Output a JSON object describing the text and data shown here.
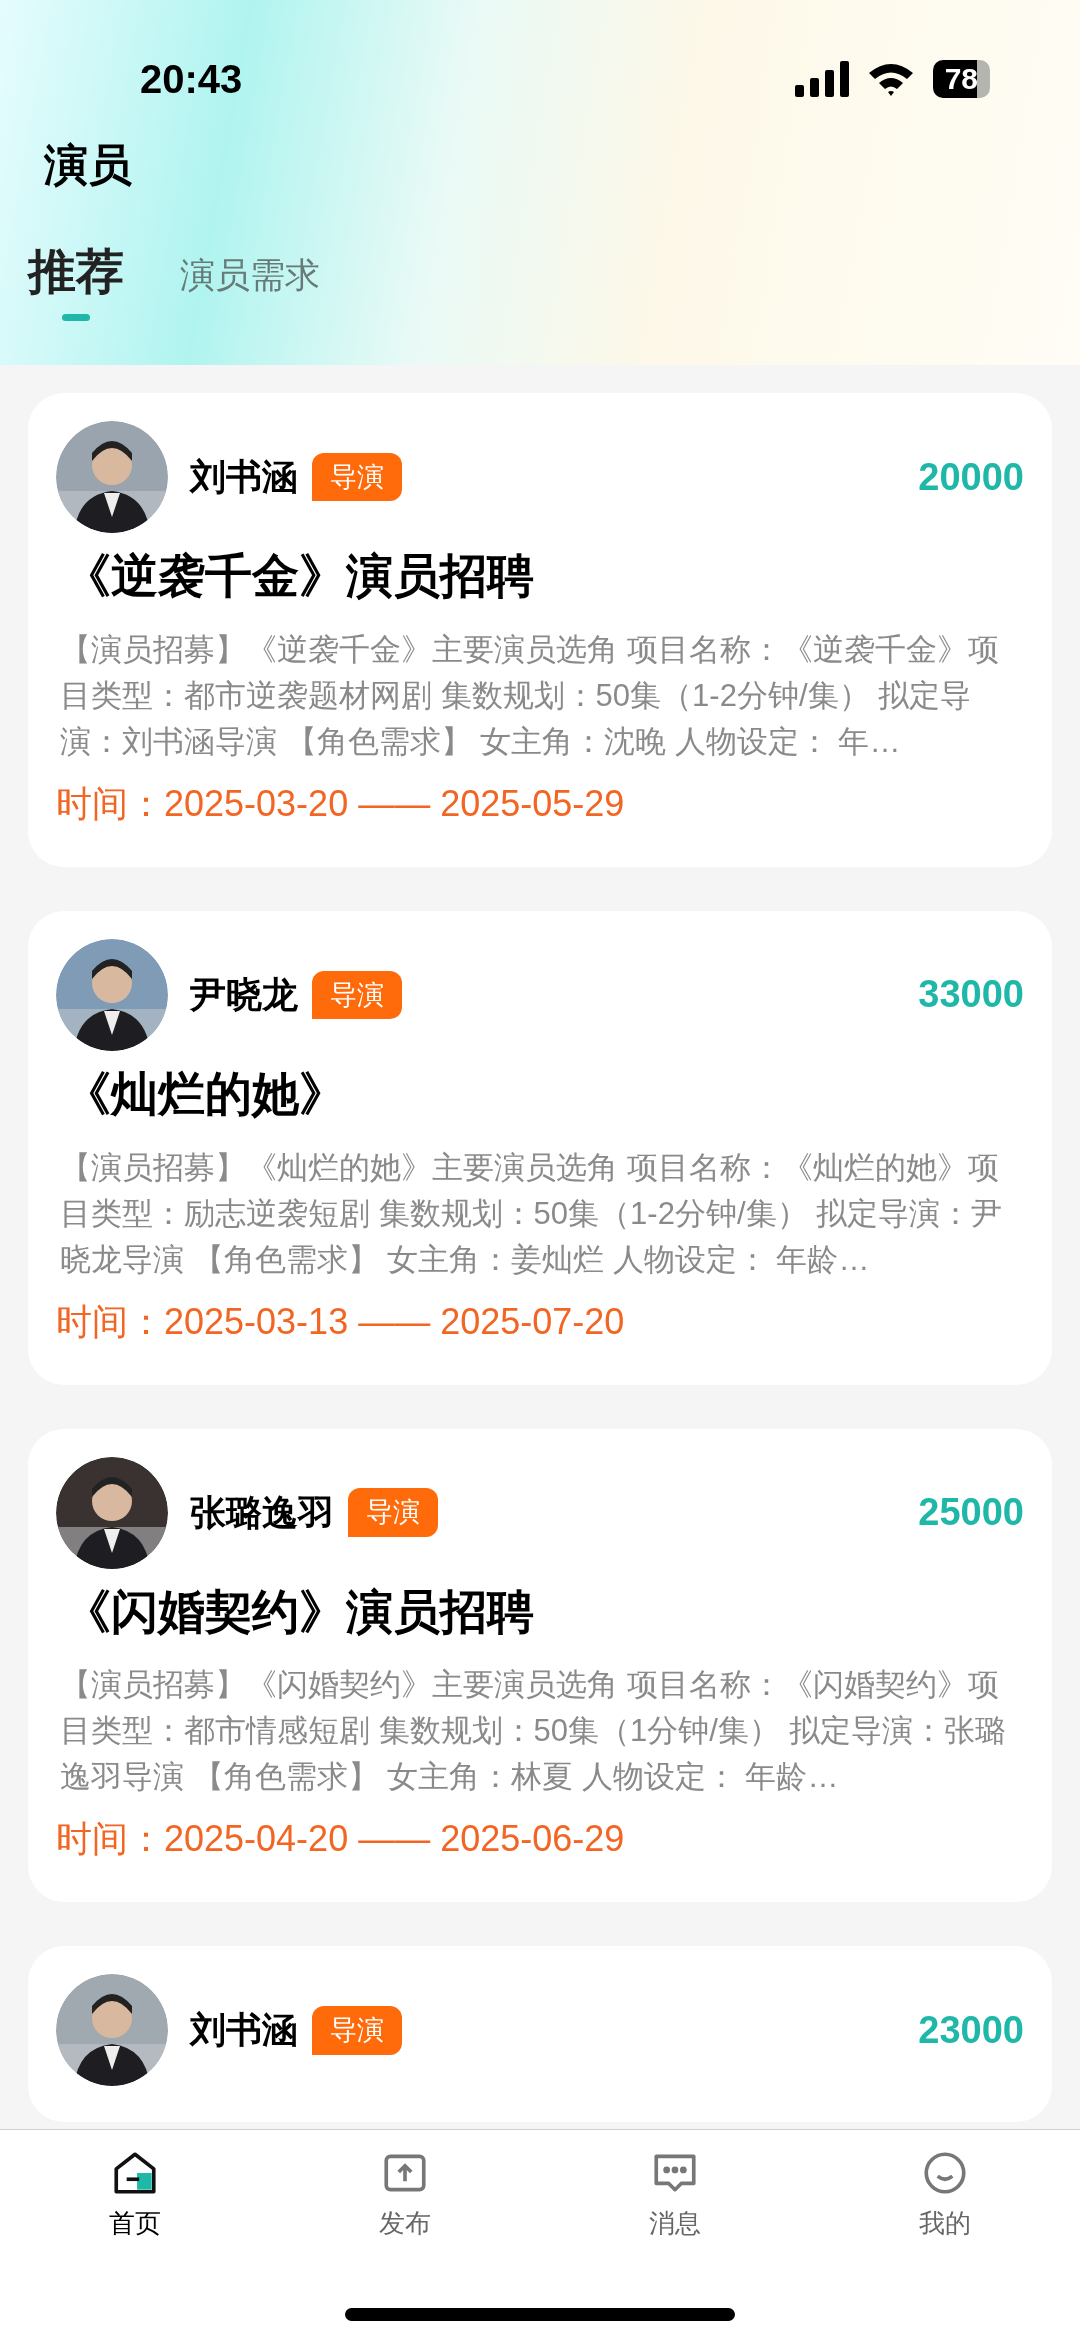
{
  "status_bar": {
    "time": "20:43",
    "battery": "78"
  },
  "page_title": "演员",
  "tabs": [
    {
      "label": "推荐",
      "selected": true
    },
    {
      "label": "演员需求",
      "selected": false
    }
  ],
  "cards": [
    {
      "name": "刘书涵",
      "role": "导演",
      "price": "20000",
      "title": "《逆袭千金》演员招聘",
      "description": "【演员招募】《逆袭千金》主要演员选角 项目名称：《逆袭千金》项目类型：都市逆袭题材网剧 集数规划：50集（1-2分钟/集） 拟定导演：刘书涵导演 【角色需求】 女主角：沈晚 人物设定： 年…",
      "time": "时间：2025-03-20 —— 2025-05-29"
    },
    {
      "name": "尹晓龙",
      "role": "导演",
      "price": "33000",
      "title": "《灿烂的她》",
      "description": "【演员招募】《灿烂的她》主要演员选角 项目名称：《灿烂的她》项目类型：励志逆袭短剧 集数规划：50集（1-2分钟/集） 拟定导演：尹晓龙导演 【角色需求】 女主角：姜灿烂 人物设定： 年龄…",
      "time": "时间：2025-03-13 —— 2025-07-20"
    },
    {
      "name": "张璐逸羽",
      "role": "导演",
      "price": "25000",
      "title": "《闪婚契约》演员招聘",
      "description": "【演员招募】《闪婚契约》主要演员选角 项目名称：《闪婚契约》项目类型：都市情感短剧 集数规划：50集（1分钟/集） 拟定导演：张璐逸羽导演 【角色需求】 女主角：林夏 人物设定： 年龄…",
      "time": "时间：2025-04-20 —— 2025-06-29"
    },
    {
      "name": "刘书涵",
      "role": "导演",
      "price": "23000"
    }
  ],
  "bottom_nav": [
    {
      "label": "首页",
      "kind": "home",
      "selected": true
    },
    {
      "label": "发布",
      "kind": "publish",
      "selected": false
    },
    {
      "label": "消息",
      "kind": "message",
      "selected": false
    },
    {
      "label": "我的",
      "kind": "profile",
      "selected": false
    }
  ]
}
